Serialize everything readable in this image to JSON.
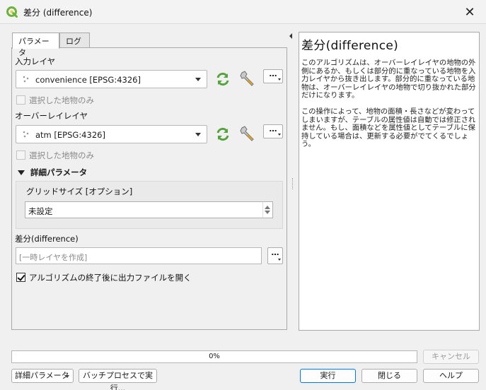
{
  "window": {
    "title": "差分 (difference)",
    "close_glyph": "✕"
  },
  "tabs": [
    {
      "label": "パラメータ",
      "active": true
    },
    {
      "label": "ログ",
      "active": false
    }
  ],
  "params": {
    "input_layer": {
      "label": "入力レイヤ",
      "value": "convenience [EPSG:4326]",
      "selected_only_label": "選択した地物のみ",
      "selected_only_checked": false
    },
    "overlay_layer": {
      "label": "オーバーレイレイヤ",
      "value": "atm [EPSG:4326]",
      "selected_only_label": "選択した地物のみ",
      "selected_only_checked": false
    },
    "advanced": {
      "header": "詳細パラメータ",
      "grid_size_label": "グリッドサイズ [オプション]",
      "grid_size_value": "未設定"
    },
    "output": {
      "label": "差分(difference)",
      "placeholder": "[一時レイヤを作成]",
      "open_after_label": "アルゴリズムの終了後に出力ファイルを開く",
      "open_after_checked": true
    },
    "dots_label": "…"
  },
  "help": {
    "title": "差分(difference)",
    "paragraphs": [
      "このアルゴリズムは、オーバーレイレイヤの地物の外側にあるか、もしくは部分的に重なっている地物を入力レイヤから抜き出します。部分的に重なっている地物は、オーバーレイレイヤの地物で切り抜かれた部分だけになります。",
      "この操作によって、地物の面積・長さなどが変わってしまいますが、テーブルの属性値は自動では修正されません。もし、面積などを属性値としてテーブルに保持している場合は、更新する必要がでてくるでしょう。"
    ]
  },
  "progress": {
    "percent": 0,
    "text": "0%"
  },
  "buttons": {
    "cancel": "キャンセル",
    "advanced": "詳細パラメータ",
    "batch": "バッチプロセスで実行...",
    "run": "実行",
    "close": "閉じる",
    "help": "ヘルプ"
  },
  "colors": {
    "qgis_green": "#6bb33d",
    "refresh_green": "#54a33c",
    "wrench": "#8c8c8c",
    "accent": "#0078d4"
  },
  "icons": {
    "app": "qgis-logo-icon",
    "layer": "point-layer-icon",
    "iterate": "iterate-icon",
    "settings": "wrench-icon"
  }
}
